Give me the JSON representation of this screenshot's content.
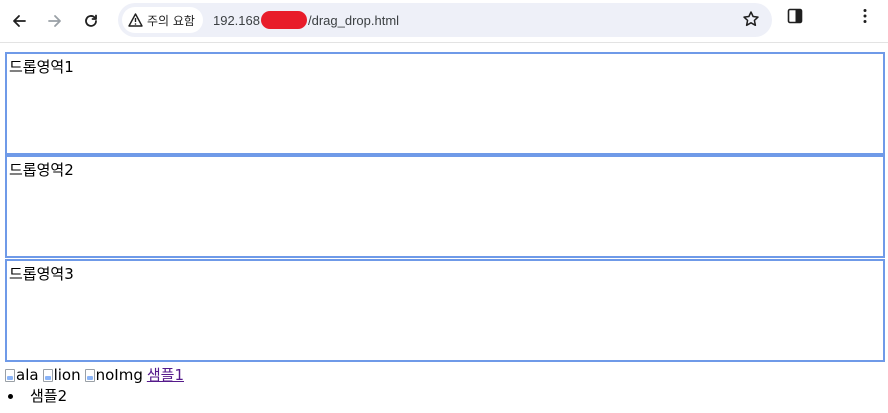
{
  "browser": {
    "security_label": "주의 요함",
    "url_prefix": "192.168",
    "url_suffix": "/drag_drop.html",
    "redaction_color": "#e81c2a"
  },
  "drop_zones": [
    {
      "label": "드롭영역1"
    },
    {
      "label": "드롭영역2"
    },
    {
      "label": "드롭영역3"
    }
  ],
  "zone_border_color": "#6f9ae8",
  "images": [
    {
      "alt": "ala"
    },
    {
      "alt": "lion"
    },
    {
      "alt": "noImg"
    }
  ],
  "sample_link": {
    "text": "샘플1",
    "color": "#551a8b"
  },
  "list_items": [
    {
      "text": "샘플2"
    }
  ]
}
